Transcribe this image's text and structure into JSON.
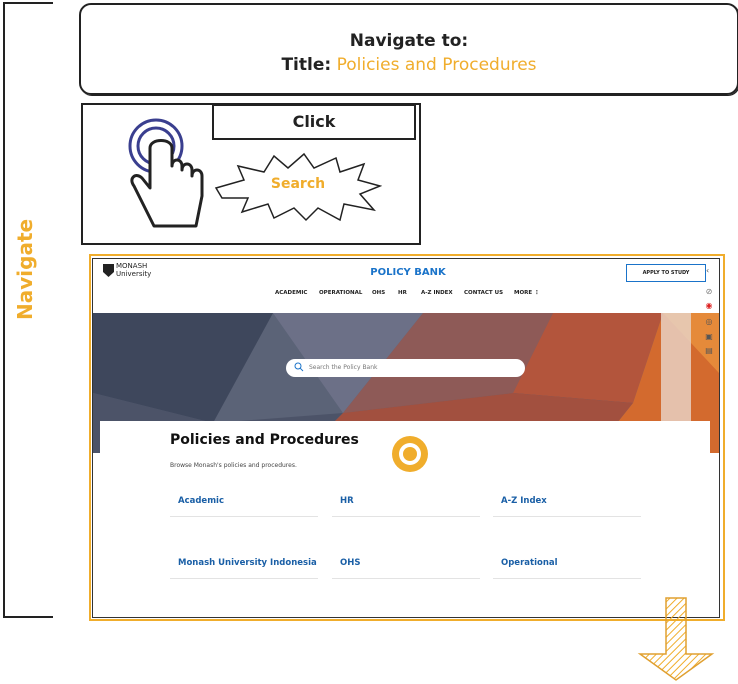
{
  "step_label": "Navigate",
  "instruction": {
    "line1": "Navigate to:",
    "title_label": "Title:",
    "title_value": "Policies and Procedures"
  },
  "action": {
    "click_label": "Click",
    "target_label": "Search"
  },
  "screenshot": {
    "logo_text_1": "MONASH",
    "logo_text_2": "University",
    "site_title": "POLICY BANK",
    "apply_button": "APPLY TO STUDY",
    "menu": [
      "ACADEMIC",
      "OPERATIONAL",
      "OHS",
      "HR",
      "A-Z INDEX",
      "CONTACT US",
      "MORE ⋮"
    ],
    "search_placeholder": "Search the Policy Bank",
    "page_title": "Policies and Procedures",
    "page_subtitle": "Browse Monash's policies and procedures.",
    "categories": [
      "Academic",
      "HR",
      "A-Z Index",
      "Monash University Indonesia",
      "OHS",
      "Operational"
    ]
  },
  "colors": {
    "accent": "#f0ad2c",
    "link": "#1a5fa6",
    "brand_blue": "#1a73c9"
  }
}
